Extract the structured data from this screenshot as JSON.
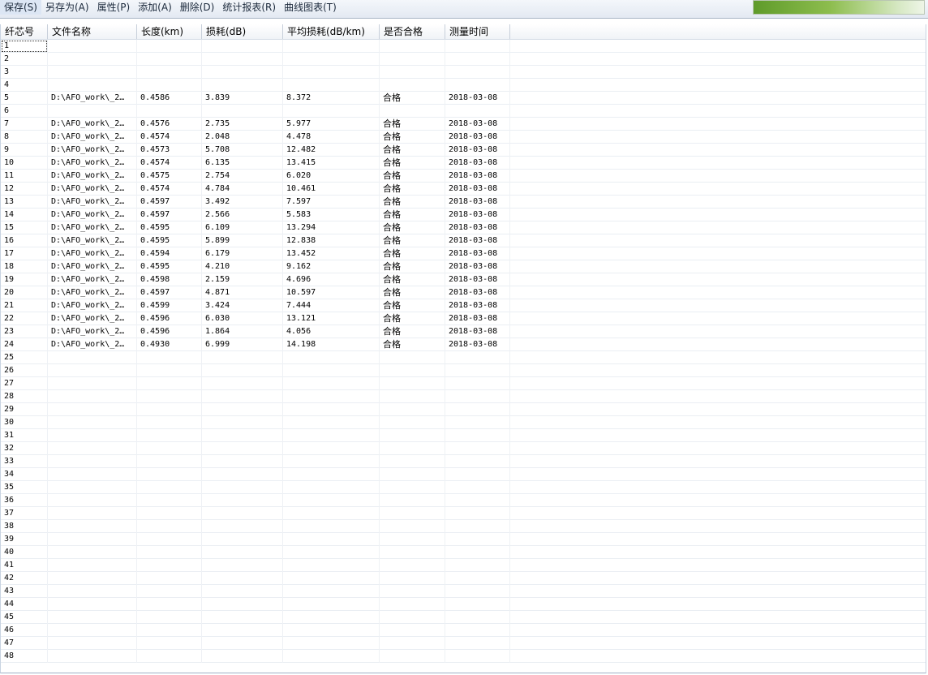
{
  "menu": [
    "保存(S)",
    "另存为(A)",
    "属性(P)",
    "添加(A)",
    "删除(D)",
    "统计报表(R)",
    "曲线图表(T)"
  ],
  "columns": [
    "纤芯号",
    "文件名称",
    "长度(km)",
    "损耗(dB)",
    "平均损耗(dB/km)",
    "是否合格",
    "测量时间",
    ""
  ],
  "rows": [
    [
      "1",
      "",
      "",
      "",
      "",
      "",
      "",
      ""
    ],
    [
      "2",
      "",
      "",
      "",
      "",
      "",
      "",
      ""
    ],
    [
      "3",
      "",
      "",
      "",
      "",
      "",
      "",
      ""
    ],
    [
      "4",
      "",
      "",
      "",
      "",
      "",
      "",
      ""
    ],
    [
      "5",
      "D:\\AFO_work\\_2…",
      "0.4586",
      "3.839",
      "8.372",
      "合格",
      "2018-03-08",
      ""
    ],
    [
      "6",
      "",
      "",
      "",
      "",
      "",
      "",
      ""
    ],
    [
      "7",
      "D:\\AFO_work\\_2…",
      "0.4576",
      "2.735",
      "5.977",
      "合格",
      "2018-03-08",
      ""
    ],
    [
      "8",
      "D:\\AFO_work\\_2…",
      "0.4574",
      "2.048",
      "4.478",
      "合格",
      "2018-03-08",
      ""
    ],
    [
      "9",
      "D:\\AFO_work\\_2…",
      "0.4573",
      "5.708",
      "12.482",
      "合格",
      "2018-03-08",
      ""
    ],
    [
      "10",
      "D:\\AFO_work\\_2…",
      "0.4574",
      "6.135",
      "13.415",
      "合格",
      "2018-03-08",
      ""
    ],
    [
      "11",
      "D:\\AFO_work\\_2…",
      "0.4575",
      "2.754",
      "6.020",
      "合格",
      "2018-03-08",
      ""
    ],
    [
      "12",
      "D:\\AFO_work\\_2…",
      "0.4574",
      "4.784",
      "10.461",
      "合格",
      "2018-03-08",
      ""
    ],
    [
      "13",
      "D:\\AFO_work\\_2…",
      "0.4597",
      "3.492",
      "7.597",
      "合格",
      "2018-03-08",
      ""
    ],
    [
      "14",
      "D:\\AFO_work\\_2…",
      "0.4597",
      "2.566",
      "5.583",
      "合格",
      "2018-03-08",
      ""
    ],
    [
      "15",
      "D:\\AFO_work\\_2…",
      "0.4595",
      "6.109",
      "13.294",
      "合格",
      "2018-03-08",
      ""
    ],
    [
      "16",
      "D:\\AFO_work\\_2…",
      "0.4595",
      "5.899",
      "12.838",
      "合格",
      "2018-03-08",
      ""
    ],
    [
      "17",
      "D:\\AFO_work\\_2…",
      "0.4594",
      "6.179",
      "13.452",
      "合格",
      "2018-03-08",
      ""
    ],
    [
      "18",
      "D:\\AFO_work\\_2…",
      "0.4595",
      "4.210",
      "9.162",
      "合格",
      "2018-03-08",
      ""
    ],
    [
      "19",
      "D:\\AFO_work\\_2…",
      "0.4598",
      "2.159",
      "4.696",
      "合格",
      "2018-03-08",
      ""
    ],
    [
      "20",
      "D:\\AFO_work\\_2…",
      "0.4597",
      "4.871",
      "10.597",
      "合格",
      "2018-03-08",
      ""
    ],
    [
      "21",
      "D:\\AFO_work\\_2…",
      "0.4599",
      "3.424",
      "7.444",
      "合格",
      "2018-03-08",
      ""
    ],
    [
      "22",
      "D:\\AFO_work\\_2…",
      "0.4596",
      "6.030",
      "13.121",
      "合格",
      "2018-03-08",
      ""
    ],
    [
      "23",
      "D:\\AFO_work\\_2…",
      "0.4596",
      "1.864",
      "4.056",
      "合格",
      "2018-03-08",
      ""
    ],
    [
      "24",
      "D:\\AFO_work\\_2…",
      "0.4930",
      "6.999",
      "14.198",
      "合格",
      "2018-03-08",
      ""
    ],
    [
      "25",
      "",
      "",
      "",
      "",
      "",
      "",
      ""
    ],
    [
      "26",
      "",
      "",
      "",
      "",
      "",
      "",
      ""
    ],
    [
      "27",
      "",
      "",
      "",
      "",
      "",
      "",
      ""
    ],
    [
      "28",
      "",
      "",
      "",
      "",
      "",
      "",
      ""
    ],
    [
      "29",
      "",
      "",
      "",
      "",
      "",
      "",
      ""
    ],
    [
      "30",
      "",
      "",
      "",
      "",
      "",
      "",
      ""
    ],
    [
      "31",
      "",
      "",
      "",
      "",
      "",
      "",
      ""
    ],
    [
      "32",
      "",
      "",
      "",
      "",
      "",
      "",
      ""
    ],
    [
      "33",
      "",
      "",
      "",
      "",
      "",
      "",
      ""
    ],
    [
      "34",
      "",
      "",
      "",
      "",
      "",
      "",
      ""
    ],
    [
      "35",
      "",
      "",
      "",
      "",
      "",
      "",
      ""
    ],
    [
      "36",
      "",
      "",
      "",
      "",
      "",
      "",
      ""
    ],
    [
      "37",
      "",
      "",
      "",
      "",
      "",
      "",
      ""
    ],
    [
      "38",
      "",
      "",
      "",
      "",
      "",
      "",
      ""
    ],
    [
      "39",
      "",
      "",
      "",
      "",
      "",
      "",
      ""
    ],
    [
      "40",
      "",
      "",
      "",
      "",
      "",
      "",
      ""
    ],
    [
      "41",
      "",
      "",
      "",
      "",
      "",
      "",
      ""
    ],
    [
      "42",
      "",
      "",
      "",
      "",
      "",
      "",
      ""
    ],
    [
      "43",
      "",
      "",
      "",
      "",
      "",
      "",
      ""
    ],
    [
      "44",
      "",
      "",
      "",
      "",
      "",
      "",
      ""
    ],
    [
      "45",
      "",
      "",
      "",
      "",
      "",
      "",
      ""
    ],
    [
      "46",
      "",
      "",
      "",
      "",
      "",
      "",
      ""
    ],
    [
      "47",
      "",
      "",
      "",
      "",
      "",
      "",
      ""
    ],
    [
      "48",
      "",
      "",
      "",
      "",
      "",
      "",
      ""
    ]
  ],
  "progress_fraction": 1.0,
  "colors": {
    "progress": "#7aad3a",
    "menubar": "#e9eef5",
    "grid_line": "#eaeef3"
  }
}
